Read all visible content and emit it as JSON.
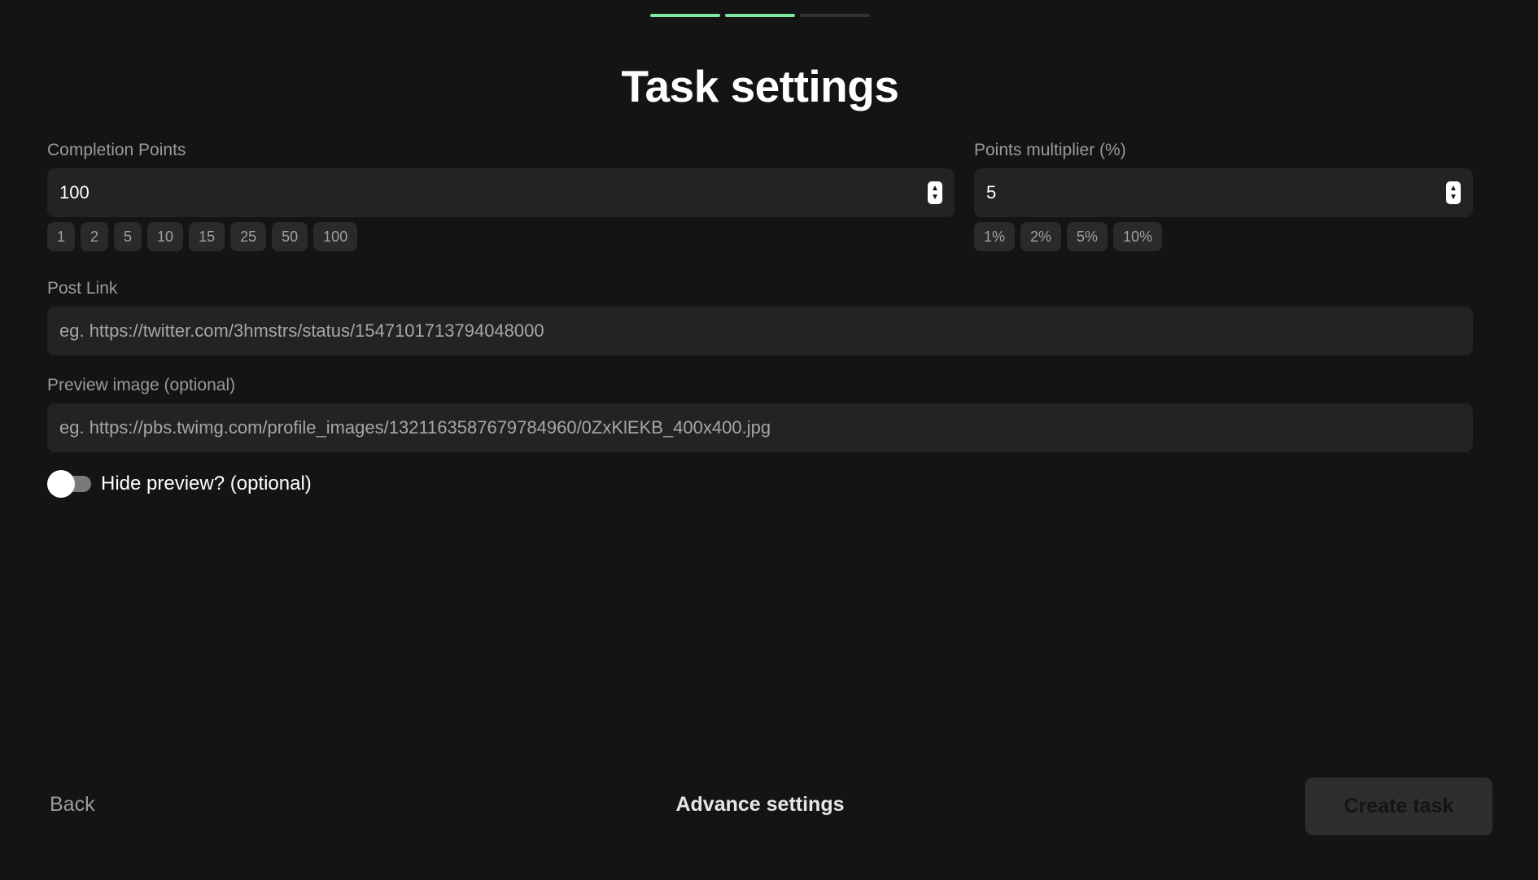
{
  "progress_steps": [
    {
      "state": "done"
    },
    {
      "state": "done"
    },
    {
      "state": "pending"
    }
  ],
  "title": "Task settings",
  "completion_points": {
    "label": "Completion Points",
    "value": "100",
    "presets": [
      "1",
      "2",
      "5",
      "10",
      "15",
      "25",
      "50",
      "100"
    ]
  },
  "points_multiplier": {
    "label": "Points multiplier (%)",
    "value": "5",
    "presets": [
      "1%",
      "2%",
      "5%",
      "10%"
    ]
  },
  "post_link": {
    "label": "Post Link",
    "placeholder": "eg. https://twitter.com/3hmstrs/status/1547101713794048000",
    "value": ""
  },
  "preview_image": {
    "label": "Preview image (optional)",
    "placeholder": "eg. https://pbs.twimg.com/profile_images/1321163587679784960/0ZxKlEKB_400x400.jpg",
    "value": ""
  },
  "hide_preview": {
    "label": "Hide preview? (optional)",
    "enabled": false
  },
  "footer": {
    "back_label": "Back",
    "advance_label": "Advance settings",
    "create_label": "Create task"
  },
  "colors": {
    "background": "#141414",
    "input_bg": "#232323",
    "accent_green": "#7ee8a2"
  }
}
